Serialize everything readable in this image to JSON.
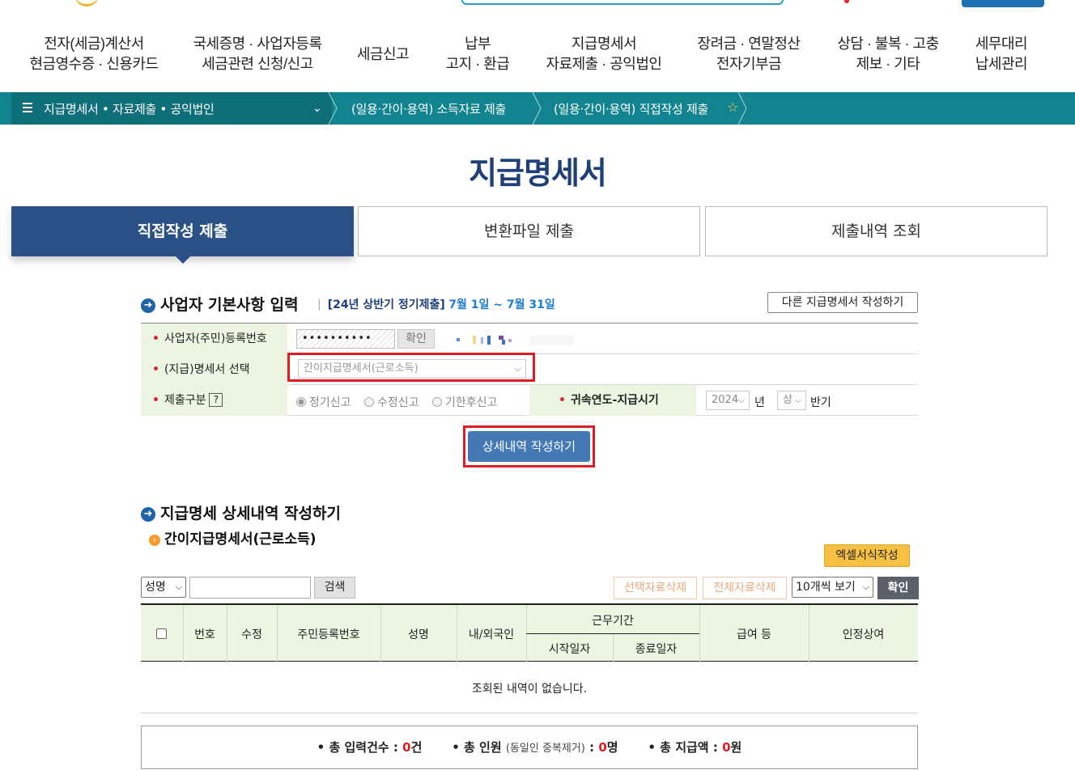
{
  "gnb": [
    {
      "line1": "전자(세금)계산서",
      "line2": "현금영수증 · 신용카드"
    },
    {
      "line1": "국세증명 · 사업자등록",
      "line2": "세금관련 신청/신고"
    },
    {
      "line1": "세금신고",
      "line2": ""
    },
    {
      "line1": "납부",
      "line2": "고지 · 환급"
    },
    {
      "line1": "지급명세서",
      "line2": "자료제출 · 공익법인"
    },
    {
      "line1": "장려금 · 연말정산",
      "line2": "전자기부금"
    },
    {
      "line1": "상담 · 불복 · 고충",
      "line2": "제보 · 기타"
    },
    {
      "line1": "세무대리",
      "line2": "납세관리"
    }
  ],
  "breadcrumb": {
    "first": "지급명세서 • 자료제출 • 공익법인",
    "second": "(일용·간이·용역) 소득자료 제출",
    "third": "(일용·간이·용역) 직접작성 제출"
  },
  "page_title": "지급명세서",
  "tabs": [
    "직접작성 제출",
    "변환파일 제출",
    "제출내역 조회"
  ],
  "basic": {
    "heading": "사업자 기본사항 입력",
    "period_label": "[24년 상반기 정기제출]",
    "period_dates": "7월 1일 ~ 7월 31일",
    "other_button": "다른 지급명세서 작성하기",
    "reg_label": "사업자(주민)등록번호",
    "reg_value": "••••••••••",
    "confirm": "확인",
    "statement_label": "(지급)명세서 선택",
    "statement_value": "간이지급명세서(근로소득)",
    "submit_type_label": "제출구분",
    "help": "?",
    "radios": [
      "정기신고",
      "수정신고",
      "기한후신고"
    ],
    "year_label": "귀속연도-지급시기",
    "year_value": "2024",
    "year_unit": "년",
    "half_value": "상",
    "half_unit": "반기",
    "detail_button": "상세내역 작성하기"
  },
  "detail": {
    "heading": "지급명세 상세내역 작성하기",
    "subheading": "간이지급명세서(근로소득)",
    "excel_button": "엑셀서식작성",
    "search_field": "성명",
    "search_button": "검색",
    "delete_selected": "선택자료삭제",
    "delete_all": "전체자료삭제",
    "page_size": "10개씩 보기",
    "apply": "확인",
    "columns": {
      "no": "번호",
      "edit": "수정",
      "rrn": "주민등록번호",
      "name": "성명",
      "nationality": "내/외국인",
      "period": "근무기간",
      "start": "시작일자",
      "end": "종료일자",
      "salary": "급여 등",
      "bonus": "인정상여"
    },
    "empty": "조회된 내역이 없습니다."
  },
  "summary": {
    "count_label": "• 총 입력건수 :",
    "count_value": "0",
    "count_unit": "건",
    "people_label": "• 총 인원",
    "people_note": "(동일인 중복제거)",
    "people_colon": ":",
    "people_value": "0",
    "people_unit": "명",
    "amount_label": "• 총 지급액 :",
    "amount_value": "0",
    "amount_unit": "원"
  }
}
